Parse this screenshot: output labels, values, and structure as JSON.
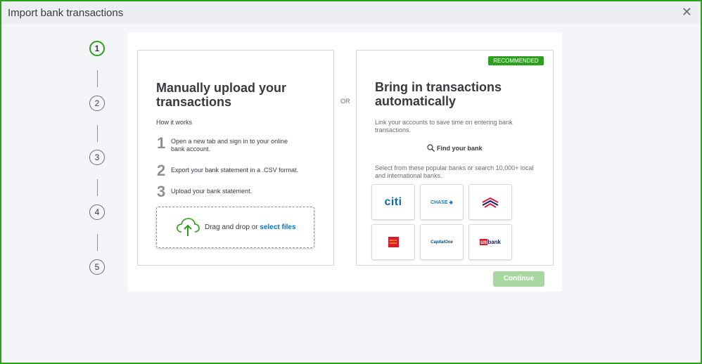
{
  "window": {
    "title": "Import bank transactions",
    "close_icon": "✕"
  },
  "stepper": {
    "steps": [
      "1",
      "2",
      "3",
      "4",
      "5"
    ],
    "active_step": "1",
    "active_color": "#2ca01c"
  },
  "manual": {
    "heading_line1": "Manually upload your",
    "heading_line2": "transactions",
    "how_it_works": "How it works",
    "steps": [
      {
        "num": "1",
        "line1": "Open a new tab and sign in to your online",
        "line2": "bank account."
      },
      {
        "num": "2",
        "line1": "Export your bank statement in a .CSV format.",
        "line2": ""
      },
      {
        "num": "3",
        "line1": "Upload your bank statement.",
        "line2": ""
      }
    ],
    "drop_text": "Drag and drop or ",
    "select_files": "select files",
    "cloud_icon": "cloud-upload-icon"
  },
  "or_label": "OR",
  "automatic": {
    "badge": "RECOMMENDED",
    "heading_line1": "Bring in transactions",
    "heading_line2": "automatically",
    "description_line1": "Link your accounts to save time on entering bank",
    "description_line2": "transactions.",
    "find_bank": "Find your bank",
    "search_icon": "search-icon",
    "popular_line1": "Select from these popular banks or search 10,000+ local",
    "popular_line2": "and international banks.",
    "banks": [
      {
        "name": "citi",
        "label": "citi"
      },
      {
        "name": "chase",
        "label": "CHASE"
      },
      {
        "name": "bank-of-america",
        "label": ""
      },
      {
        "name": "wells-fargo",
        "label": "WELLS FARGO"
      },
      {
        "name": "capital-one",
        "label": "CapitalOne"
      },
      {
        "name": "us-bank",
        "label_prefix": "us",
        "label": "bank"
      }
    ]
  },
  "continue_label": "Continue",
  "colors": {
    "brand_green": "#2ca01c",
    "link_blue": "#0077c5",
    "continue_disabled": "#a8d8a0"
  }
}
